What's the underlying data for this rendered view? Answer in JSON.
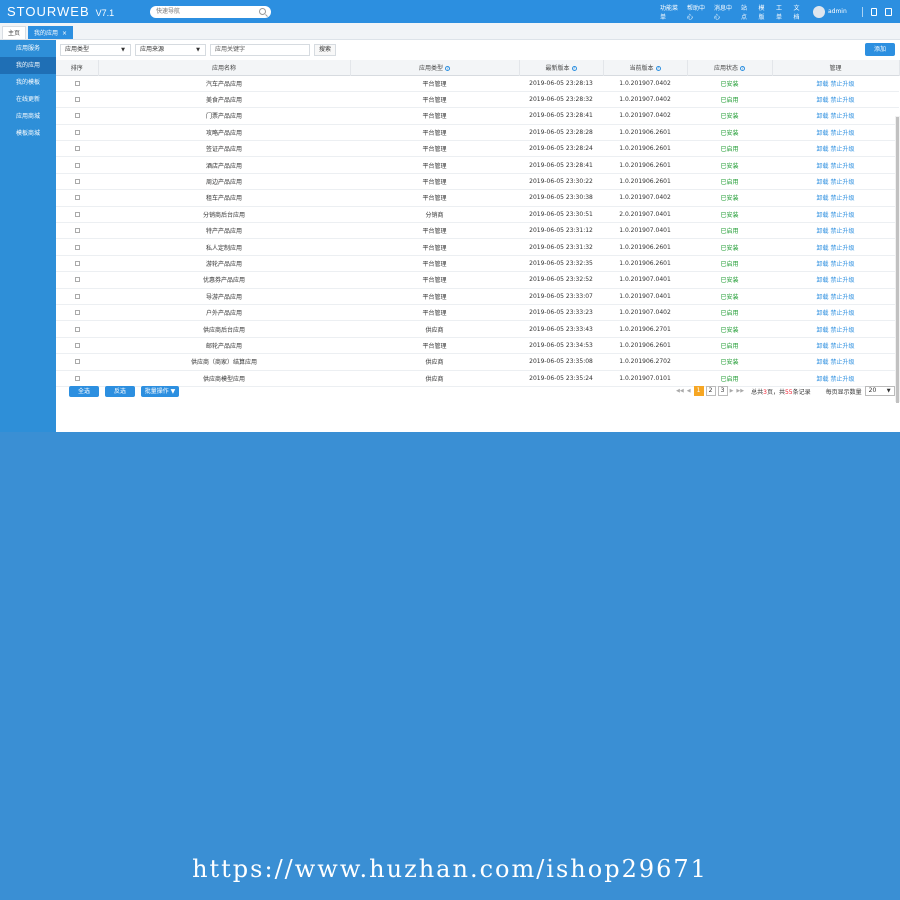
{
  "header": {
    "logo": "STOURWEB",
    "version": "V7.1",
    "search_placeholder": "快速导航",
    "nav": [
      "功能菜单",
      "帮助中心",
      "消息中心",
      "站点",
      "模版",
      "工单",
      "文档"
    ],
    "user": "admin"
  },
  "tabs": [
    {
      "label": "主页"
    },
    {
      "label": "我的应用",
      "close": "×"
    }
  ],
  "sidebar": {
    "items": [
      "应用服务",
      "我的应用",
      "我的模板",
      "在线更新",
      "应用商城",
      "模板商城"
    ]
  },
  "filters": {
    "type": "应用类型",
    "source": "应用来源",
    "keyword_placeholder": "应用关键字",
    "search": "搜索",
    "add": "添加"
  },
  "table": {
    "headers": [
      "排序",
      "应用名称",
      "应用类型",
      "最新版本",
      "当前版本",
      "应用状态",
      "管理"
    ],
    "rows": [
      [
        "汽车产品应用",
        "平台管理",
        "2019-06-05 23:28:13",
        "1.0.201907.0402",
        "已安装",
        "卸载 禁止升级"
      ],
      [
        "美食产品应用",
        "平台管理",
        "2019-06-05 23:28:32",
        "1.0.201907.0402",
        "已启用",
        "卸载 禁止升级"
      ],
      [
        "门票产品应用",
        "平台管理",
        "2019-06-05 23:28:41",
        "1.0.201907.0402",
        "已安装",
        "卸载 禁止升级"
      ],
      [
        "攻略产品应用",
        "平台管理",
        "2019-06-05 23:28:28",
        "1.0.201906.2601",
        "已安装",
        "卸载 禁止升级"
      ],
      [
        "签证产品应用",
        "平台管理",
        "2019-06-05 23:28:24",
        "1.0.201906.2601",
        "已启用",
        "卸载 禁止升级"
      ],
      [
        "酒店产品应用",
        "平台管理",
        "2019-06-05 23:28:41",
        "1.0.201906.2601",
        "已安装",
        "卸载 禁止升级"
      ],
      [
        "周边产品应用",
        "平台管理",
        "2019-06-05 23:30:22",
        "1.0.201906.2601",
        "已启用",
        "卸载 禁止升级"
      ],
      [
        "租车产品应用",
        "平台管理",
        "2019-06-05 23:30:38",
        "1.0.201907.0402",
        "已安装",
        "卸载 禁止升级"
      ],
      [
        "分销商后台应用",
        "分销商",
        "2019-06-05 23:30:51",
        "2.0.201907.0401",
        "已安装",
        "卸载 禁止升级"
      ],
      [
        "特产产品应用",
        "平台管理",
        "2019-06-05 23:31:12",
        "1.0.201907.0401",
        "已启用",
        "卸载 禁止升级"
      ],
      [
        "私人定制应用",
        "平台管理",
        "2019-06-05 23:31:32",
        "1.0.201906.2601",
        "已安装",
        "卸载 禁止升级"
      ],
      [
        "游轮产品应用",
        "平台管理",
        "2019-06-05 23:32:35",
        "1.0.201906.2601",
        "已启用",
        "卸载 禁止升级"
      ],
      [
        "优惠券产品应用",
        "平台管理",
        "2019-06-05 23:32:52",
        "1.0.201907.0401",
        "已安装",
        "卸载 禁止升级"
      ],
      [
        "导游产品应用",
        "平台管理",
        "2019-06-05 23:33:07",
        "1.0.201907.0401",
        "已安装",
        "卸载 禁止升级"
      ],
      [
        "户外产品应用",
        "平台管理",
        "2019-06-05 23:33:23",
        "1.0.201907.0402",
        "已启用",
        "卸载 禁止升级"
      ],
      [
        "供应商后台应用",
        "供应商",
        "2019-06-05 23:33:43",
        "1.0.201906.2701",
        "已安装",
        "卸载 禁止升级"
      ],
      [
        "邮轮产品应用",
        "平台管理",
        "2019-06-05 23:34:53",
        "1.0.201906.2601",
        "已启用",
        "卸载 禁止升级"
      ],
      [
        "供应商（商家）结算应用",
        "供应商",
        "2019-06-05 23:35:08",
        "1.0.201906.2702",
        "已安装",
        "卸载 禁止升级"
      ],
      [
        "供应商模型应用",
        "供应商",
        "2019-06-05 23:35:24",
        "1.0.201907.0101",
        "已启用",
        "卸载 禁止升级"
      ]
    ]
  },
  "footer": {
    "select_all": "全选",
    "invert": "反选",
    "batch": "批量操作",
    "pages": [
      "1",
      "2",
      "3"
    ],
    "total_prefix": "总共",
    "total_pages": "3",
    "total_mid": "页，共",
    "total_records": "55",
    "total_suffix": "条记录",
    "per_page_label": "每页显示数量",
    "per_page": "20"
  },
  "watermark": "https://www.huzhan.com/ishop29671"
}
